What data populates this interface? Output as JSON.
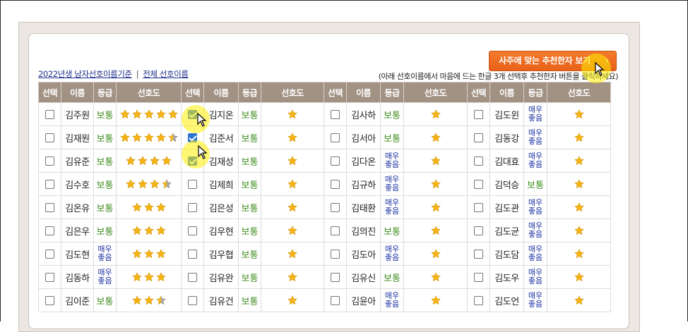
{
  "cta_button": {
    "label": "사주에 맞는 추천한자 보기",
    "chevron": "›"
  },
  "links": {
    "current": "2022년생 남자선호이름기준",
    "separator": "|",
    "all": "전체 선호이름"
  },
  "hint": "(아래 선호이름에서 마음에 드는 한글 3개 선택후 추천한자 버튼을 클릭하세요)",
  "headers": {
    "select": "선택",
    "name": "이름",
    "grade": "등급",
    "preference": "선호도"
  },
  "grade_labels": {
    "normal": "보통",
    "good_line1": "매우",
    "good_line2": "좋음"
  },
  "colors": {
    "header_bg": "#a29284",
    "cta": "#ee6d22",
    "normal_grade": "#3f8d1f",
    "good_grade": "#1a2fa0",
    "star": "#f5b315"
  },
  "rows": [
    [
      {
        "name": "김주원",
        "grade": "normal",
        "stars": 5,
        "checked": false
      },
      {
        "name": "김지온",
        "grade": "normal",
        "stars": 1,
        "checked": true
      },
      {
        "name": "김사하",
        "grade": "normal",
        "stars": 1,
        "checked": false
      },
      {
        "name": "김도윈",
        "grade": "good",
        "stars": 1,
        "checked": false
      }
    ],
    [
      {
        "name": "김재원",
        "grade": "normal",
        "stars": 4.5,
        "checked": false
      },
      {
        "name": "김준서",
        "grade": "normal",
        "stars": 1,
        "checked": true
      },
      {
        "name": "김서아",
        "grade": "normal",
        "stars": 1,
        "checked": false
      },
      {
        "name": "김동강",
        "grade": "good",
        "stars": 1,
        "checked": false
      }
    ],
    [
      {
        "name": "김유준",
        "grade": "normal",
        "stars": 4,
        "checked": false
      },
      {
        "name": "김재성",
        "grade": "normal",
        "stars": 1,
        "checked": true
      },
      {
        "name": "김다온",
        "grade": "good",
        "stars": 1,
        "checked": false
      },
      {
        "name": "김대효",
        "grade": "good",
        "stars": 1,
        "checked": false
      }
    ],
    [
      {
        "name": "김수호",
        "grade": "normal",
        "stars": 3.5,
        "checked": false
      },
      {
        "name": "김제희",
        "grade": "normal",
        "stars": 1,
        "checked": false
      },
      {
        "name": "김규하",
        "grade": "good",
        "stars": 1,
        "checked": false
      },
      {
        "name": "김덕승",
        "grade": "normal",
        "stars": 1,
        "checked": false
      }
    ],
    [
      {
        "name": "김온유",
        "grade": "normal",
        "stars": 3,
        "checked": false
      },
      {
        "name": "김은성",
        "grade": "normal",
        "stars": 1,
        "checked": false
      },
      {
        "name": "김태환",
        "grade": "good",
        "stars": 1,
        "checked": false
      },
      {
        "name": "김도관",
        "grade": "good",
        "stars": 1,
        "checked": false
      }
    ],
    [
      {
        "name": "김은우",
        "grade": "normal",
        "stars": 3,
        "checked": false
      },
      {
        "name": "김우현",
        "grade": "normal",
        "stars": 1,
        "checked": false
      },
      {
        "name": "김의진",
        "grade": "normal",
        "stars": 1,
        "checked": false
      },
      {
        "name": "김도균",
        "grade": "good",
        "stars": 1,
        "checked": false
      }
    ],
    [
      {
        "name": "김도현",
        "grade": "good",
        "stars": 3,
        "checked": false
      },
      {
        "name": "김우협",
        "grade": "normal",
        "stars": 1,
        "checked": false
      },
      {
        "name": "김도아",
        "grade": "good",
        "stars": 1,
        "checked": false
      },
      {
        "name": "김도담",
        "grade": "good",
        "stars": 1,
        "checked": false
      }
    ],
    [
      {
        "name": "김동하",
        "grade": "good",
        "stars": 3,
        "checked": false
      },
      {
        "name": "김유완",
        "grade": "normal",
        "stars": 1,
        "checked": false
      },
      {
        "name": "김유신",
        "grade": "normal",
        "stars": 1,
        "checked": false
      },
      {
        "name": "김도우",
        "grade": "good",
        "stars": 1,
        "checked": false
      }
    ],
    [
      {
        "name": "김이준",
        "grade": "normal",
        "stars": 2.5,
        "checked": false
      },
      {
        "name": "김유건",
        "grade": "normal",
        "stars": 1,
        "checked": false
      },
      {
        "name": "김윤아",
        "grade": "good",
        "stars": 1,
        "checked": false
      },
      {
        "name": "김도언",
        "grade": "good",
        "stars": 1,
        "checked": false
      }
    ]
  ]
}
